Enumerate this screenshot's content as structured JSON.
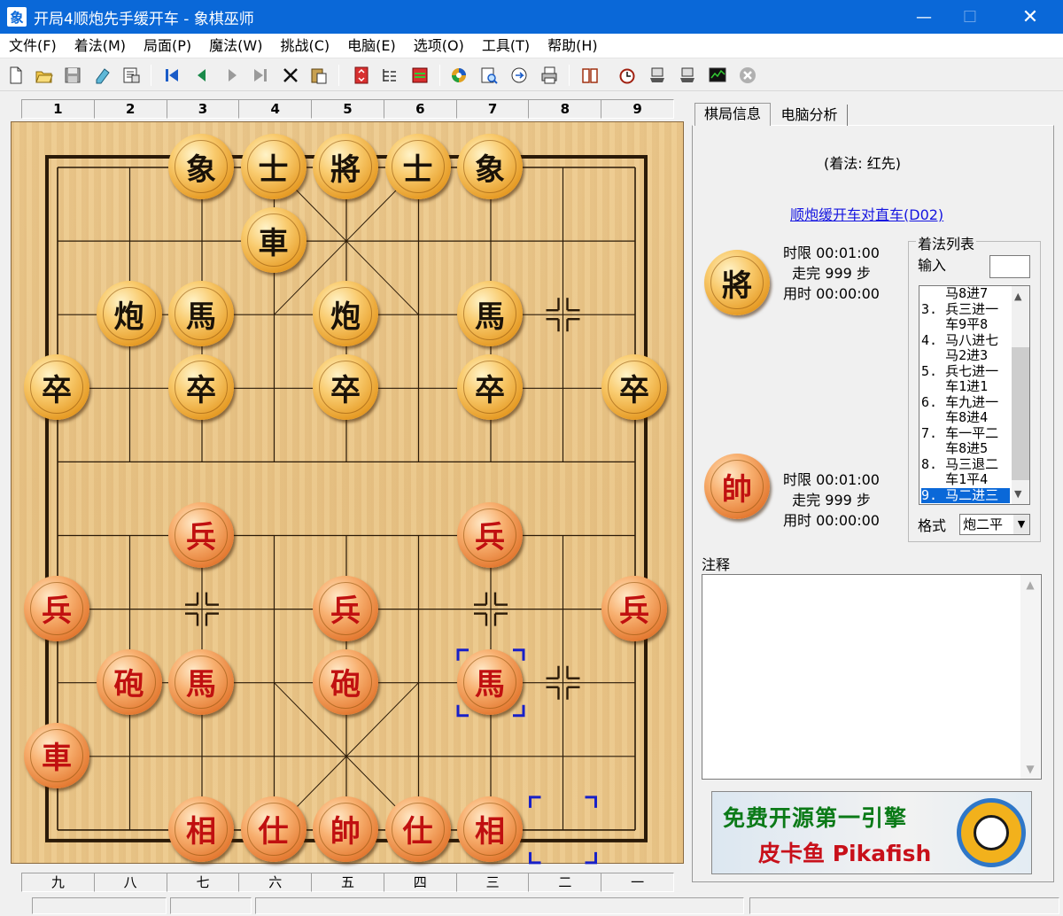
{
  "window": {
    "title": "开局4顺炮先手缓开车 - 象棋巫师",
    "app_icon": "象"
  },
  "menu": [
    "文件(F)",
    "着法(M)",
    "局面(P)",
    "魔法(W)",
    "挑战(C)",
    "电脑(E)",
    "选项(O)",
    "工具(T)",
    "帮助(H)"
  ],
  "toolbar": {
    "icons": [
      "new-icon",
      "open-icon",
      "save-icon",
      "edit-icon",
      "properties-icon",
      "first-move-icon",
      "prev-move-icon",
      "next-move-icon",
      "last-move-icon",
      "delete-icon",
      "paste-icon",
      "flip-board-icon",
      "move-tree-icon",
      "evaluate-icon",
      "engine-icon",
      "search-icon",
      "export-icon",
      "print-icon",
      "book-icon",
      "timer-icon",
      "computer-black-icon",
      "computer-red-icon",
      "analysis-icon",
      "stop-icon"
    ]
  },
  "board": {
    "top_ruler": [
      "1",
      "2",
      "3",
      "4",
      "5",
      "6",
      "7",
      "8",
      "9"
    ],
    "bottom_ruler": [
      "九",
      "八",
      "七",
      "六",
      "五",
      "四",
      "三",
      "二",
      "一"
    ],
    "pieces": [
      {
        "color": "black",
        "char": "象",
        "col": 2,
        "row": 0
      },
      {
        "color": "black",
        "char": "士",
        "col": 3,
        "row": 0
      },
      {
        "color": "black",
        "char": "將",
        "col": 4,
        "row": 0
      },
      {
        "color": "black",
        "char": "士",
        "col": 5,
        "row": 0
      },
      {
        "color": "black",
        "char": "象",
        "col": 6,
        "row": 0
      },
      {
        "color": "black",
        "char": "車",
        "col": 3,
        "row": 1
      },
      {
        "color": "black",
        "char": "炮",
        "col": 1,
        "row": 2
      },
      {
        "color": "black",
        "char": "馬",
        "col": 2,
        "row": 2
      },
      {
        "color": "black",
        "char": "炮",
        "col": 4,
        "row": 2
      },
      {
        "color": "black",
        "char": "馬",
        "col": 6,
        "row": 2
      },
      {
        "color": "black",
        "char": "卒",
        "col": 0,
        "row": 3
      },
      {
        "color": "black",
        "char": "卒",
        "col": 2,
        "row": 3
      },
      {
        "color": "black",
        "char": "卒",
        "col": 4,
        "row": 3
      },
      {
        "color": "black",
        "char": "卒",
        "col": 6,
        "row": 3
      },
      {
        "color": "black",
        "char": "卒",
        "col": 8,
        "row": 3
      },
      {
        "color": "red",
        "char": "兵",
        "col": 2,
        "row": 5
      },
      {
        "color": "red",
        "char": "兵",
        "col": 6,
        "row": 5
      },
      {
        "color": "red",
        "char": "兵",
        "col": 0,
        "row": 6
      },
      {
        "color": "red",
        "char": "兵",
        "col": 4,
        "row": 6
      },
      {
        "color": "red",
        "char": "兵",
        "col": 8,
        "row": 6
      },
      {
        "color": "red",
        "char": "砲",
        "col": 1,
        "row": 7
      },
      {
        "color": "red",
        "char": "馬",
        "col": 2,
        "row": 7
      },
      {
        "color": "red",
        "char": "砲",
        "col": 4,
        "row": 7
      },
      {
        "color": "red",
        "char": "馬",
        "col": 6,
        "row": 7
      },
      {
        "color": "red",
        "char": "車",
        "col": 0,
        "row": 8
      },
      {
        "color": "red",
        "char": "相",
        "col": 2,
        "row": 9
      },
      {
        "color": "red",
        "char": "仕",
        "col": 3,
        "row": 9
      },
      {
        "color": "red",
        "char": "帥",
        "col": 4,
        "row": 9
      },
      {
        "color": "red",
        "char": "仕",
        "col": 5,
        "row": 9
      },
      {
        "color": "red",
        "char": "相",
        "col": 6,
        "row": 9
      }
    ],
    "last_move": {
      "from": {
        "col": 7,
        "row": 9
      },
      "to": {
        "col": 6,
        "row": 7
      }
    },
    "empty_point_marks": [
      {
        "col": 7,
        "row": 2
      },
      {
        "col": 2,
        "row": 6
      },
      {
        "col": 6,
        "row": 6
      },
      {
        "col": 7,
        "row": 7
      }
    ]
  },
  "panel": {
    "tabs": [
      "棋局信息",
      "电脑分析"
    ],
    "move_note": "(着法: 红先)",
    "opening_link": "顺炮缓开车对直车(D02)",
    "black_side": {
      "piece": "將",
      "time_limit": "时限 00:01:00",
      "moves": "  走完 999 步",
      "used": "用时 00:00:00"
    },
    "red_side": {
      "piece": "帥",
      "time_limit": "时限 00:01:00",
      "moves": "  走完 999 步",
      "used": "用时 00:00:00"
    },
    "move_list": {
      "legend": "着法列表",
      "input_label": "输入",
      "items": [
        "   马8进7",
        "3. 兵三进一",
        "   车9平8",
        "4. 马八进七",
        "   马2进3",
        "5. 兵七进一",
        "   车1进1",
        "6. 车九进一",
        "   车8进4",
        "7. 车一平二",
        "   车8进5",
        "8. 马三退二",
        "   车1平4",
        "9. 马二进三"
      ],
      "selected_index": 13,
      "format_label": "格式",
      "format_value": "炮二平"
    },
    "notes_label": "注释",
    "banner": {
      "line1": "免费开源第一引擎",
      "line2": "皮卡鱼 Pikafish"
    }
  }
}
